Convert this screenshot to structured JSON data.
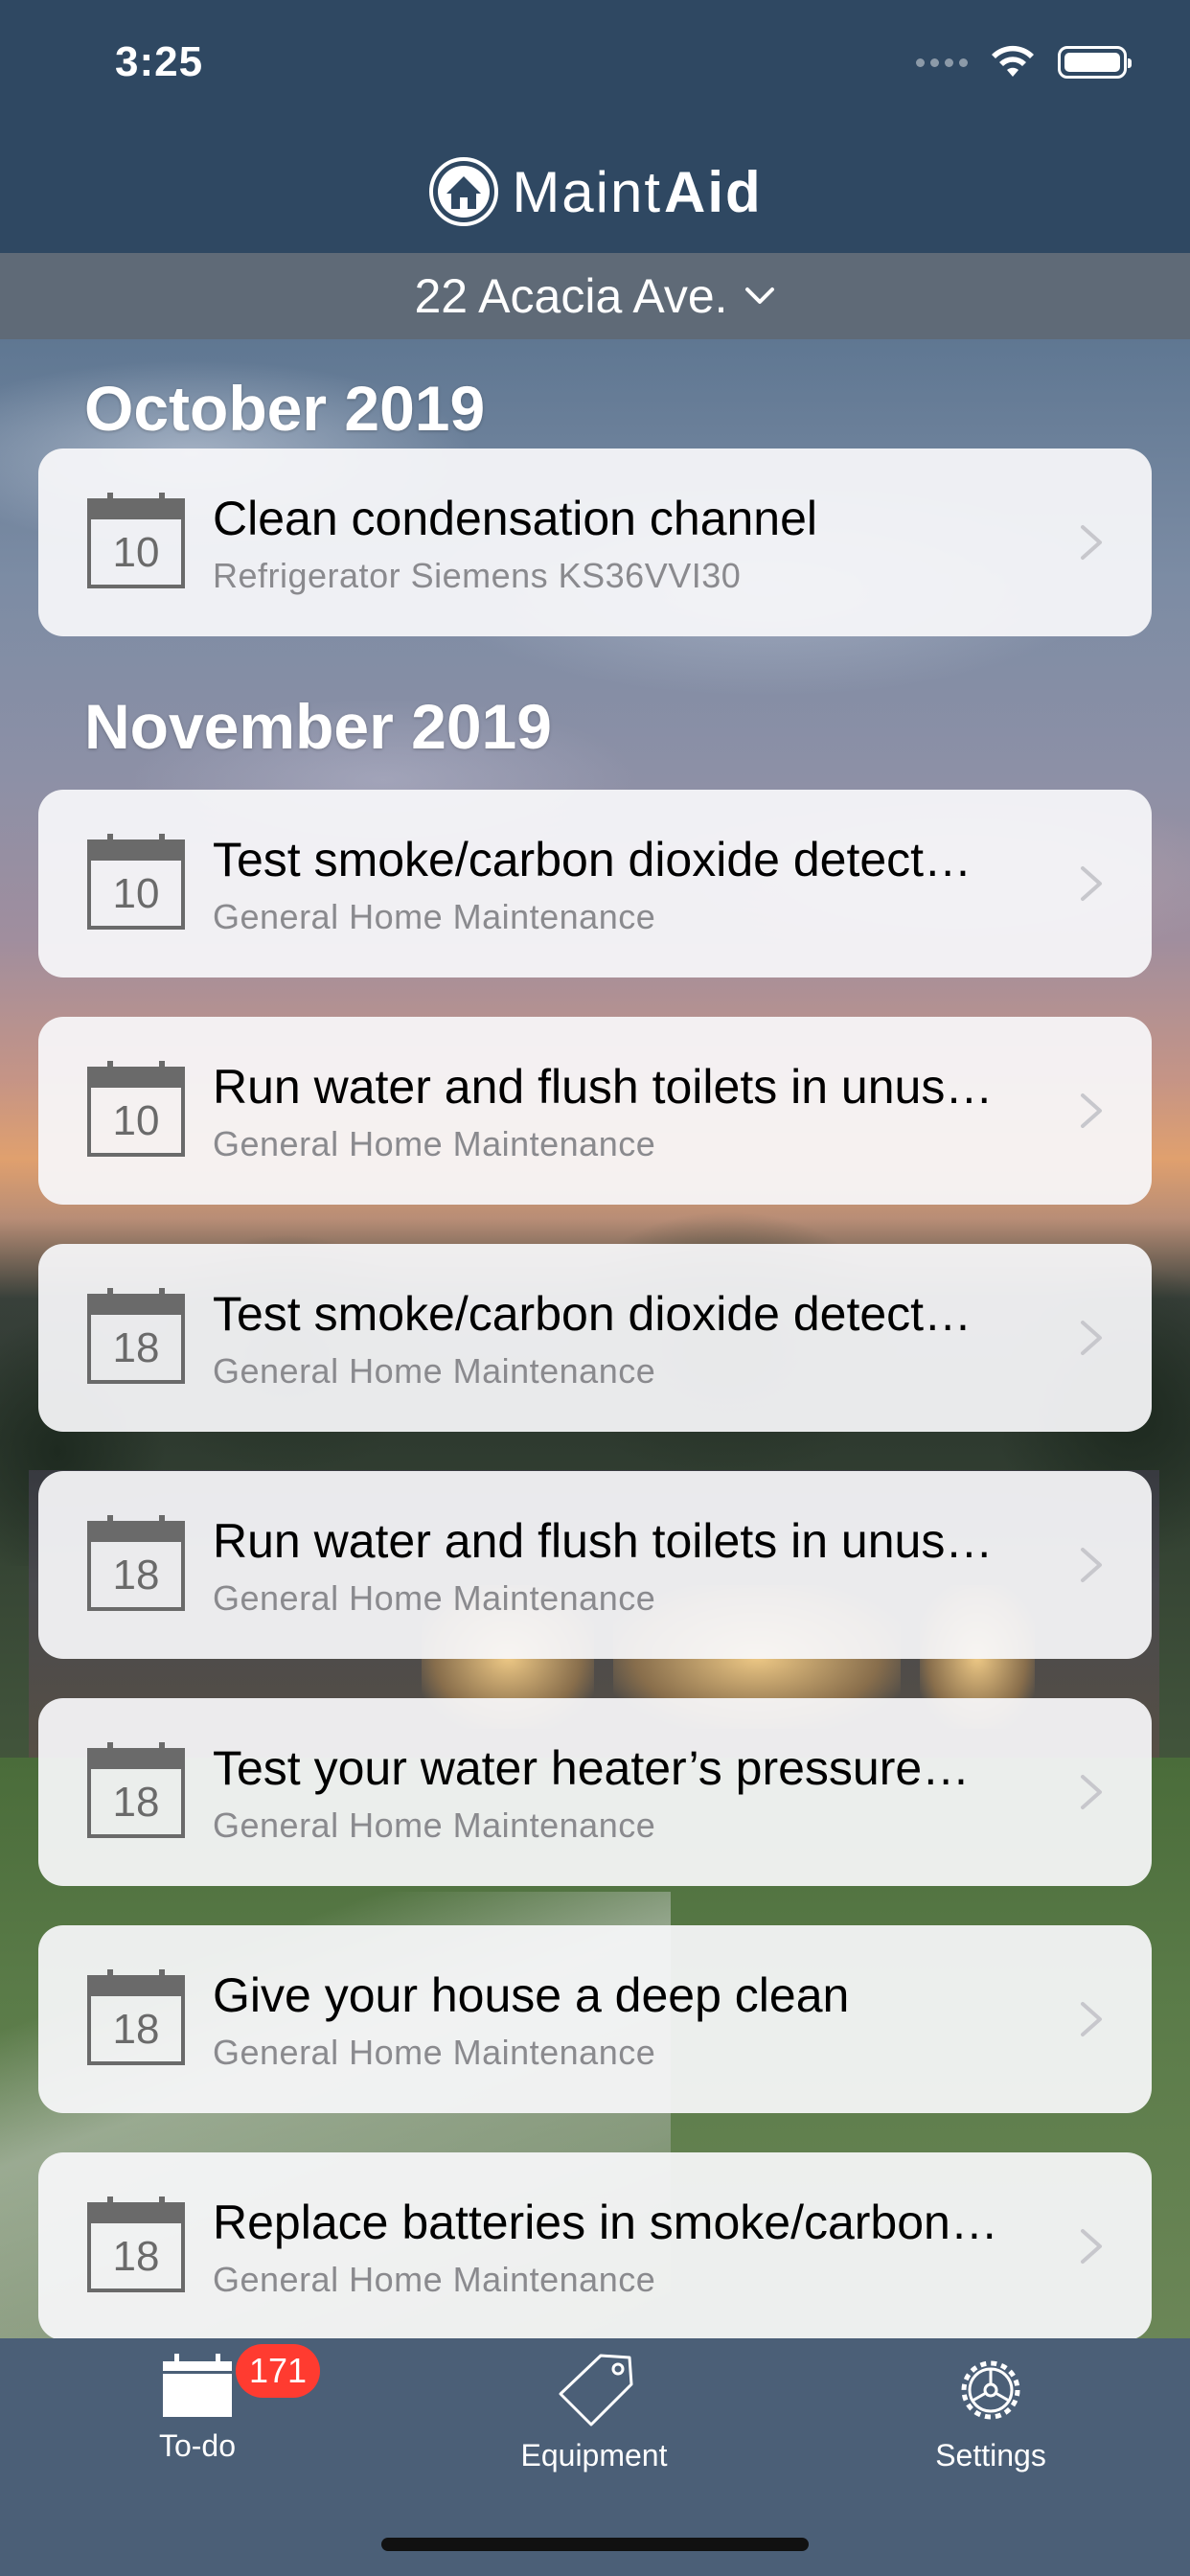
{
  "status": {
    "time": "3:25"
  },
  "app": {
    "brand_part1": "Maint",
    "brand_part2": "Aid"
  },
  "location": {
    "selected": "22 Acacia Ave."
  },
  "sections": [
    {
      "month": "October 2019",
      "tasks": [
        {
          "day": "10",
          "title": "Clean condensation channel",
          "subtitle": "Refrigerator Siemens KS36VVI30"
        }
      ]
    },
    {
      "month": "November 2019",
      "tasks": [
        {
          "day": "10",
          "title": "Test smoke/carbon dioxide detect…",
          "subtitle": "General Home Maintenance"
        },
        {
          "day": "10",
          "title": "Run water and flush toilets in unus…",
          "subtitle": "General Home Maintenance"
        },
        {
          "day": "18",
          "title": "Test smoke/carbon dioxide detect…",
          "subtitle": "General Home Maintenance"
        },
        {
          "day": "18",
          "title": "Run water and flush toilets in unus…",
          "subtitle": "General Home Maintenance"
        },
        {
          "day": "18",
          "title": "Test your water heater’s pressure…",
          "subtitle": "General Home Maintenance"
        },
        {
          "day": "18",
          "title": "Give your house a deep clean",
          "subtitle": "General Home Maintenance"
        },
        {
          "day": "18",
          "title": "Replace batteries in smoke/carbon…",
          "subtitle": "General Home Maintenance"
        }
      ]
    }
  ],
  "tabbar": {
    "todo_label": "To-do",
    "todo_badge": "171",
    "equipment_label": "Equipment",
    "settings_label": "Settings"
  },
  "icons": {
    "calendar": "calendar-icon",
    "chevron": "chevron-right-icon",
    "tag": "tag-icon",
    "gear": "gear-icon",
    "logo": "house-logo-icon"
  },
  "colors": {
    "nav_background": "#2f4862",
    "tabbar_background": "#4b5f77",
    "badge": "#ff3b30",
    "card_background": "#f8f8fa"
  }
}
